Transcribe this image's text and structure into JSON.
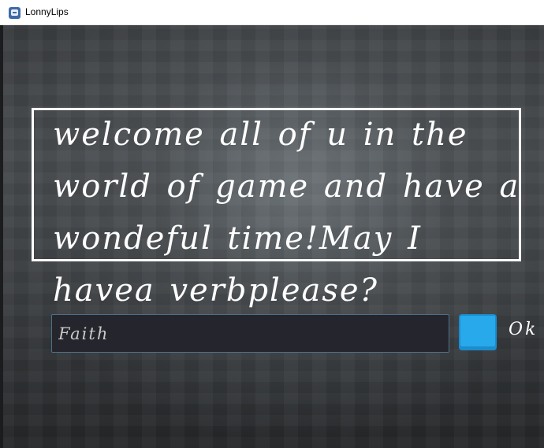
{
  "window": {
    "title": "LonnyLips",
    "icon": "game-app-icon"
  },
  "story": {
    "text": "welcome all of u in the world of game and have a wondeful time!May I havea verbplease?"
  },
  "input": {
    "value": "Faith",
    "placeholder": ""
  },
  "ok": {
    "label": "Ok",
    "color": "#27a9ec"
  }
}
